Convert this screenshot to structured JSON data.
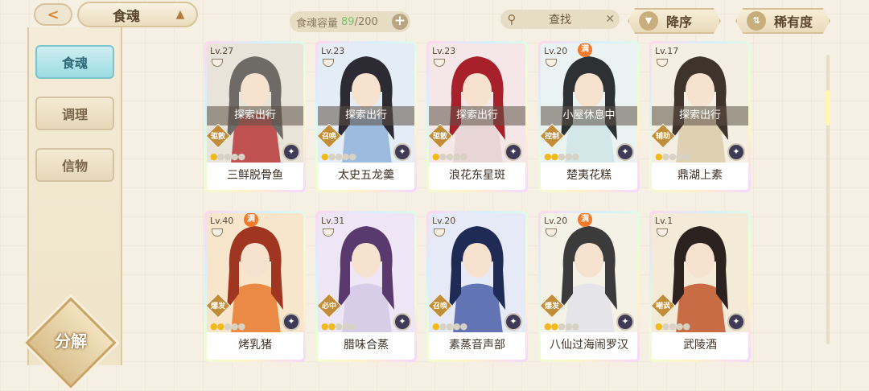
{
  "header": {
    "back_icon": "back-arrow-icon",
    "title": "食魂",
    "capacity_label": "食魂容量",
    "capacity_current": "89",
    "capacity_max": "/200",
    "search_label": "查找",
    "sort_order_label": "降序",
    "sort_rarity_label": "稀有度"
  },
  "sidebar": {
    "tabs": [
      {
        "label": "食魂",
        "active": true
      },
      {
        "label": "调理",
        "active": false
      },
      {
        "label": "信物",
        "active": false
      }
    ],
    "decompose_label": "分解"
  },
  "cards": [
    {
      "level": "Lv.27",
      "status": "探索出行",
      "role": "驱散",
      "stars": 1,
      "name": "三鲜脱骨鱼",
      "full": false,
      "palette": [
        "#e9e4da",
        "#6e6a66",
        "#b83a3a"
      ]
    },
    {
      "level": "Lv.23",
      "status": "探索出行",
      "role": "召唤",
      "stars": 1,
      "name": "太史五龙羹",
      "full": false,
      "palette": [
        "#e4ecf6",
        "#2c2a33",
        "#8fb3d9"
      ]
    },
    {
      "level": "Lv.23",
      "status": "探索出行",
      "role": "驱散",
      "stars": 1,
      "name": "浪花东星斑",
      "full": false,
      "palette": [
        "#f5e7e7",
        "#a8202a",
        "#e5d1d1"
      ]
    },
    {
      "level": "Lv.20",
      "status": "小屋休息中",
      "role": "控制",
      "stars": 2,
      "name": "楚夷花糕",
      "full": true,
      "palette": [
        "#eaf3f2",
        "#2d3133",
        "#cfe3e6"
      ]
    },
    {
      "level": "Lv.17",
      "status": "探索出行",
      "role": "辅助",
      "stars": 1,
      "name": "鼎湖上素",
      "full": false,
      "palette": [
        "#f4efe2",
        "#3e342c",
        "#d8cba8"
      ]
    },
    {
      "level": "Lv.40",
      "status": "",
      "role": "爆发",
      "stars": 2,
      "name": "烤乳猪",
      "full": true,
      "palette": [
        "#f8e6cc",
        "#a03622",
        "#e8792c"
      ]
    },
    {
      "level": "Lv.31",
      "status": "",
      "role": "必中",
      "stars": 2,
      "name": "腊味合蒸",
      "full": false,
      "palette": [
        "#eee6f4",
        "#5a3a6e",
        "#d4c8e6"
      ]
    },
    {
      "level": "Lv.20",
      "status": "",
      "role": "召唤",
      "stars": 1,
      "name": "素蒸音声部",
      "full": false,
      "palette": [
        "#e6eaf6",
        "#1f2b55",
        "#4a5fa8"
      ]
    },
    {
      "level": "Lv.20",
      "status": "",
      "role": "爆发",
      "stars": 2,
      "name": "八仙过海闹罗汉",
      "full": true,
      "palette": [
        "#f4f1e6",
        "#3b3b3b",
        "#e2e2e8"
      ]
    },
    {
      "level": "Lv.1",
      "status": "",
      "role": "嘲讽",
      "stars": 1,
      "name": "武陵酒",
      "full": false,
      "palette": [
        "#f3ead8",
        "#2c2220",
        "#c0562c"
      ]
    }
  ],
  "icons": {
    "search": "search-icon",
    "clear": "close-icon",
    "sort": "sort-down-icon",
    "rarity": "rarity-icon",
    "add": "plus-icon"
  },
  "accent_colors": {
    "active_tab": "#9bdce2",
    "star": "#f2b91c",
    "full_badge": "#f27a2c"
  }
}
